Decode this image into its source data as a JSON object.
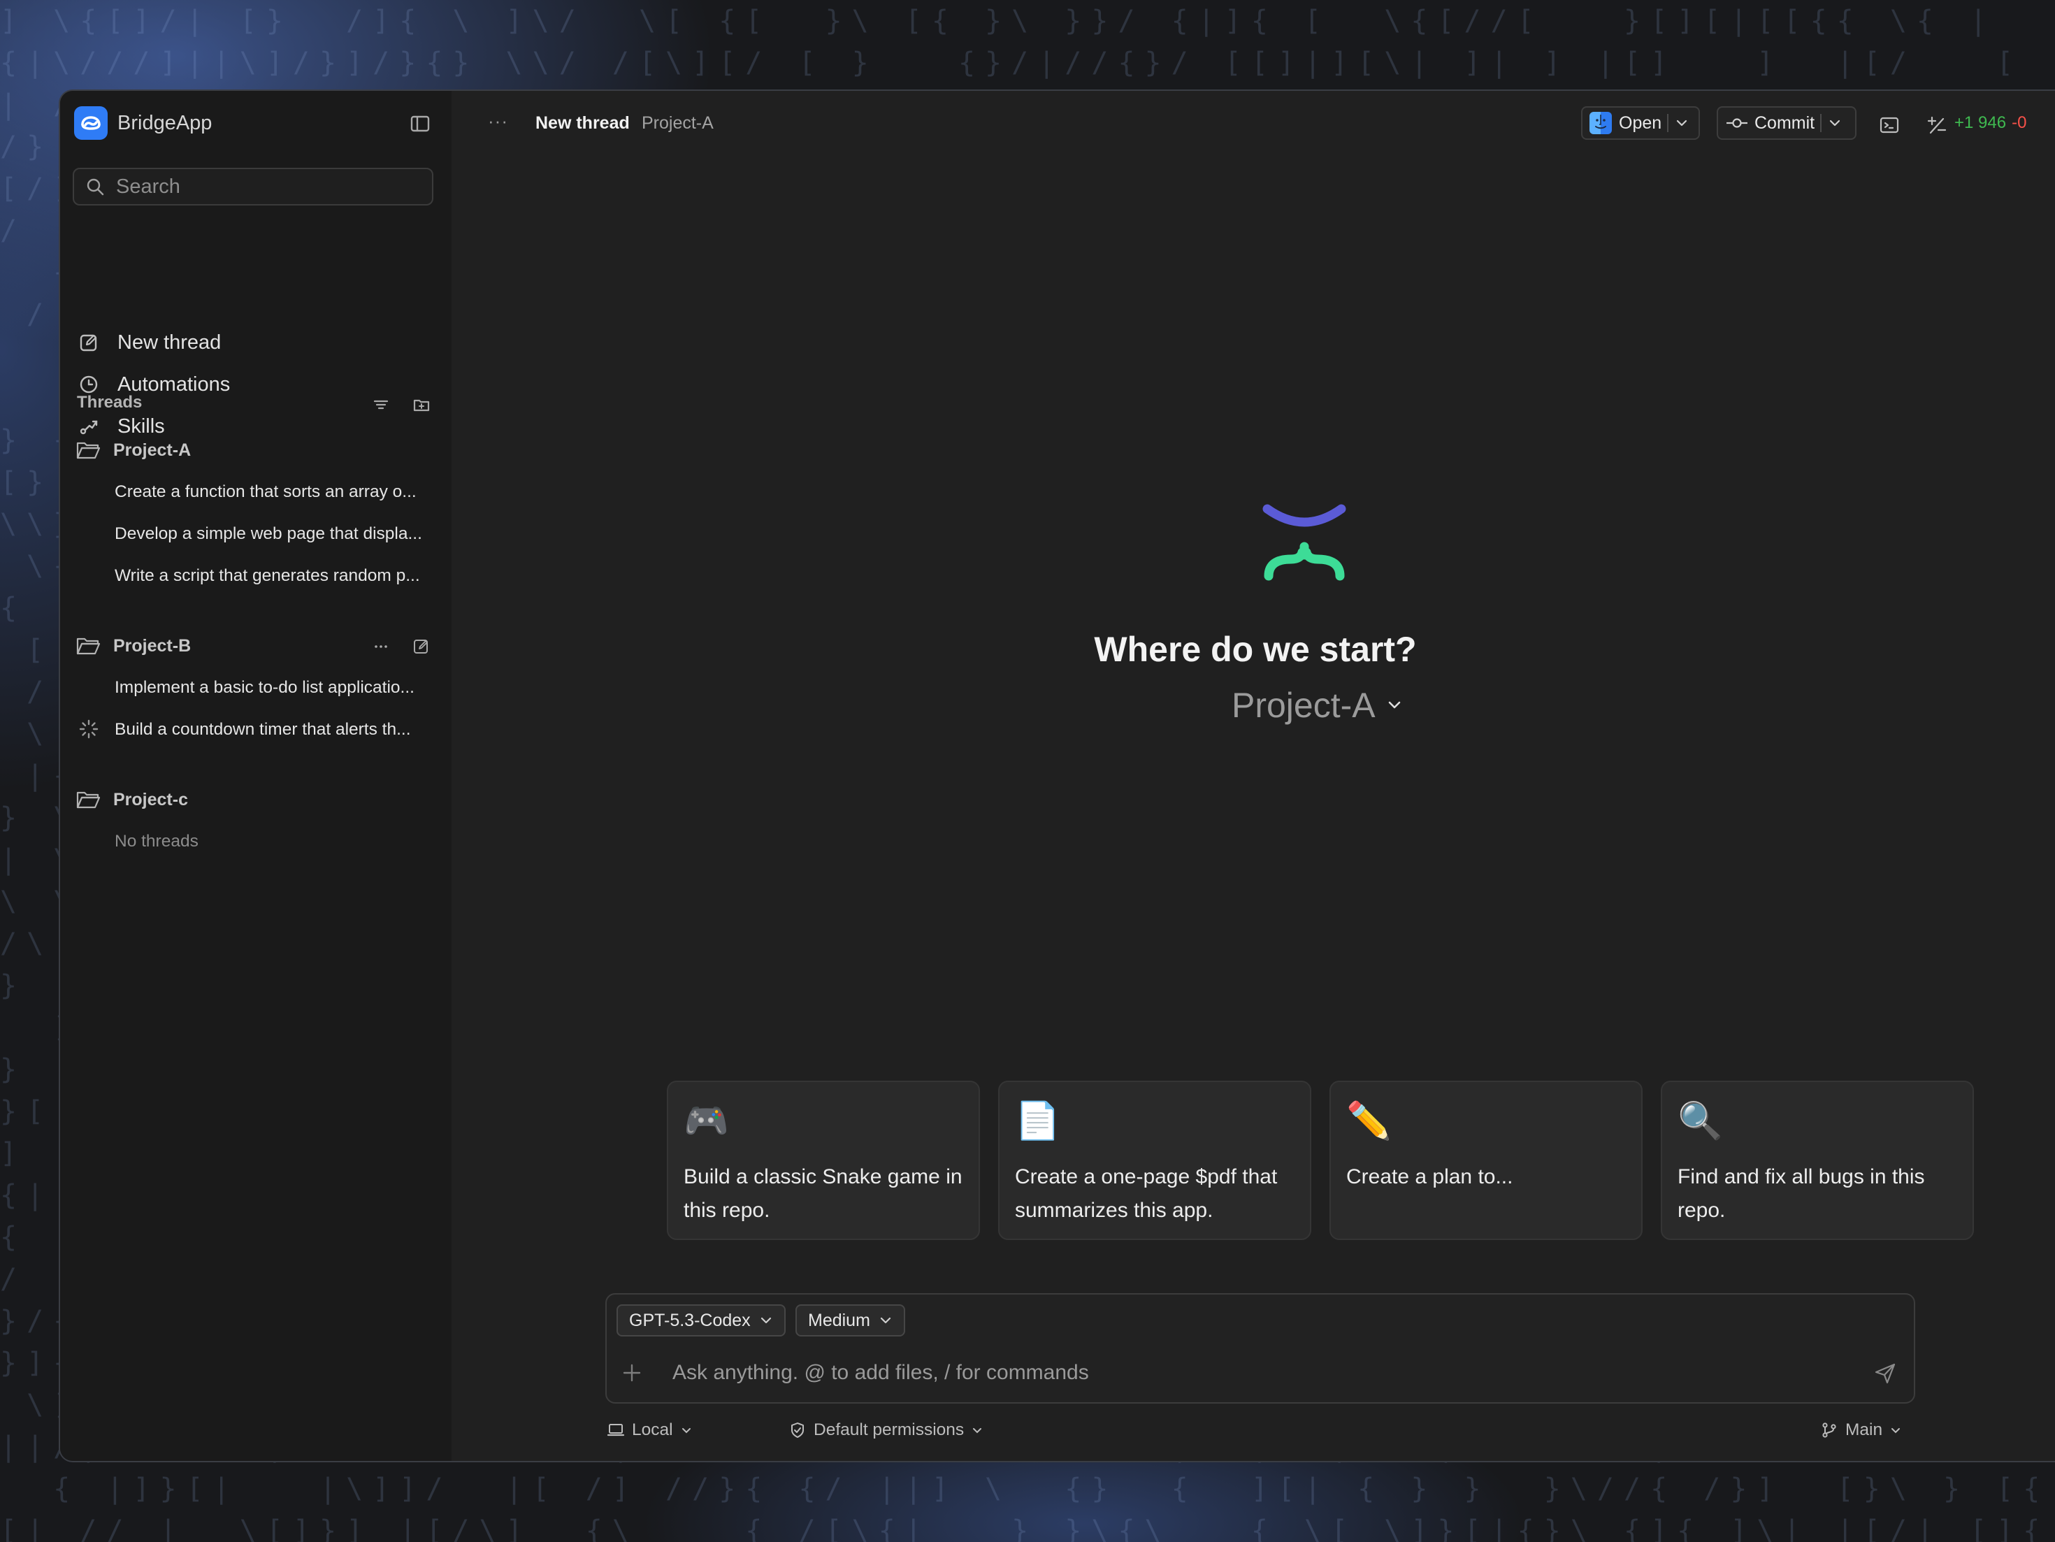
{
  "app": {
    "name": "BridgeApp"
  },
  "search": {
    "placeholder": "Search"
  },
  "nav": {
    "new_thread": "New thread",
    "automations": "Automations",
    "skills": "Skills"
  },
  "threads": {
    "title": "Threads",
    "projects": [
      {
        "name": "Project-A",
        "items": [
          "Create a function that sorts an array o...",
          "Develop a simple web page that displa...",
          "Write a script that generates random p..."
        ]
      },
      {
        "name": "Project-B",
        "items": [
          "Implement a basic to-do list applicatio...",
          "Build a countdown timer that alerts th..."
        ]
      },
      {
        "name": "Project-c",
        "empty": "No threads"
      }
    ]
  },
  "topbar": {
    "title": "New thread",
    "project": "Project-A",
    "more": "···",
    "open_label": "Open",
    "commit_label": "Commit",
    "diff_add": "+1 946",
    "diff_del": "-0"
  },
  "hero": {
    "title": "Where do we start?",
    "project": "Project-A"
  },
  "suggestions": [
    {
      "emoji": "🎮",
      "text": "Build a classic Snake game in this repo."
    },
    {
      "emoji": "📄",
      "text": "Create a one-page $pdf that summarizes this app."
    },
    {
      "emoji": "✏️",
      "text": "Create a plan to..."
    },
    {
      "emoji": "🔍",
      "text": "Find and fix all bugs in this repo."
    }
  ],
  "composer": {
    "model": "GPT-5.3-Codex",
    "effort": "Medium",
    "placeholder": "Ask anything. @ to add files, / for commands"
  },
  "footer": {
    "env": "Local",
    "permissions": "Default permissions",
    "branch": "Main"
  },
  "colors": {
    "accent_blue": "#2f7cf6",
    "logo_top": "#5b5bd6",
    "logo_bottom": "#3ddc97",
    "diff_add": "#3fb950",
    "diff_del": "#f85149"
  }
}
